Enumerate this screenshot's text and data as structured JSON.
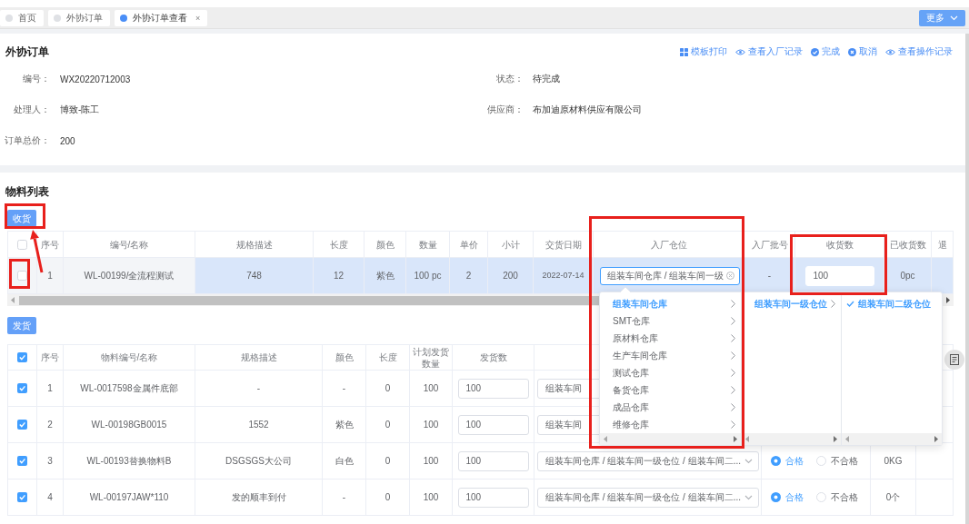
{
  "tabs": [
    {
      "label": "首页",
      "selected": false
    },
    {
      "label": "外协订单",
      "selected": false
    },
    {
      "label": "外协订单查看",
      "selected": true,
      "close": "×"
    }
  ],
  "more_button": {
    "label": "更多"
  },
  "order": {
    "title": "外协订单",
    "actions": [
      {
        "kind": "print",
        "label": "模板打印"
      },
      {
        "kind": "view",
        "label": "查看入厂记录"
      },
      {
        "kind": "complete",
        "label": "完成"
      },
      {
        "kind": "cancel",
        "label": "取消"
      },
      {
        "kind": "view",
        "label": "查看操作记录"
      }
    ],
    "fields": [
      {
        "label": "编号：",
        "value": "WX20220712003"
      },
      {
        "label": "状态：",
        "value": "待完成"
      },
      {
        "label": "处理人：",
        "value": "博致-陈工"
      },
      {
        "label": "供应商：",
        "value": "布加迪原材料供应有限公司"
      },
      {
        "label": "订单总价：",
        "value": "200"
      }
    ]
  },
  "materials": {
    "title": "物料列表",
    "receive_button": "收货",
    "receive_table": {
      "select_all": false,
      "columns": [
        "序号",
        "编号/名称",
        "规格描述",
        "长度",
        "颜色",
        "数量",
        "单价",
        "小计",
        "交货日期",
        "入厂仓位",
        "入厂批号",
        "收货数",
        "已收货数",
        "退"
      ],
      "rows": [
        {
          "selected": true,
          "checked": false,
          "cells": [
            {
              "kind": "text",
              "text": "1"
            },
            {
              "kind": "text",
              "text": "WL-00199/全流程测试"
            },
            {
              "kind": "text",
              "text": "748"
            },
            {
              "kind": "text",
              "text": "12"
            },
            {
              "kind": "text",
              "text": "紫色"
            },
            {
              "kind": "text",
              "text": "100 pc"
            },
            {
              "kind": "text",
              "text": "2"
            },
            {
              "kind": "text",
              "text": "200"
            },
            {
              "kind": "date",
              "text": "2022-07-14"
            },
            {
              "kind": "cascader",
              "value": "组装车间仓库 / 组装车间一级",
              "open": true
            },
            {
              "kind": "text",
              "text": "-"
            },
            {
              "kind": "input",
              "value": "100"
            },
            {
              "kind": "text",
              "text": "0pc"
            }
          ]
        }
      ]
    },
    "ship_button": "发货",
    "ship_table": {
      "select_all": true,
      "columns": [
        "序号",
        "物料编号/名称",
        "规格描述",
        "颜色",
        "长度",
        "计划发货数量",
        "发货数"
      ],
      "rows": [
        {
          "checked": true,
          "cells": [
            {
              "kind": "text",
              "text": "1"
            },
            {
              "kind": "text",
              "text": "WL-0017598金属件底部"
            },
            {
              "kind": "text",
              "text": "-"
            },
            {
              "kind": "text",
              "text": "-"
            },
            {
              "kind": "text",
              "text": "0"
            },
            {
              "kind": "text",
              "text": "100"
            },
            {
              "kind": "input",
              "value": "100"
            },
            {
              "kind": "select_partial",
              "value": "组装车间"
            }
          ]
        },
        {
          "checked": true,
          "cells": [
            {
              "kind": "text",
              "text": "2"
            },
            {
              "kind": "text",
              "text": "WL-00198GB0015"
            },
            {
              "kind": "text",
              "text": "1552"
            },
            {
              "kind": "text",
              "text": "紫色"
            },
            {
              "kind": "text",
              "text": "0"
            },
            {
              "kind": "text",
              "text": "100"
            },
            {
              "kind": "input",
              "value": "100"
            },
            {
              "kind": "select_partial",
              "value": "组装车间"
            }
          ]
        },
        {
          "checked": true,
          "cells": [
            {
              "kind": "text",
              "text": "3"
            },
            {
              "kind": "text",
              "text": "WL-00193替换物料B"
            },
            {
              "kind": "text",
              "text": "DSGSGS大公司"
            },
            {
              "kind": "text",
              "text": "白色"
            },
            {
              "kind": "text",
              "text": "0"
            },
            {
              "kind": "text",
              "text": "100"
            },
            {
              "kind": "input",
              "value": "100"
            },
            {
              "kind": "select",
              "value": "组装车间仓库 / 组装车间一级仓位 / 组装车间二..."
            },
            {
              "kind": "radio",
              "options": [
                {
                  "label": "合格",
                  "selected": true
                },
                {
                  "label": "不合格",
                  "selected": false
                }
              ]
            },
            {
              "kind": "text",
              "text": "0KG"
            }
          ]
        },
        {
          "checked": true,
          "cells": [
            {
              "kind": "text",
              "text": "4"
            },
            {
              "kind": "text",
              "text": "WL-00197JAW*110"
            },
            {
              "kind": "text",
              "text": "发的顺丰到付"
            },
            {
              "kind": "text",
              "text": "-"
            },
            {
              "kind": "text",
              "text": "0"
            },
            {
              "kind": "text",
              "text": "100"
            },
            {
              "kind": "input",
              "value": "100"
            },
            {
              "kind": "select",
              "value": "组装车间仓库 / 组装车间一级仓位 / 组装车间二..."
            },
            {
              "kind": "radio",
              "options": [
                {
                  "label": "合格",
                  "selected": true
                },
                {
                  "label": "不合格",
                  "selected": false
                }
              ]
            },
            {
              "kind": "text",
              "text": "0个"
            }
          ]
        }
      ]
    }
  },
  "cascader_menu": {
    "columns": [
      {
        "items": [
          {
            "label": "组装车间仓库",
            "selected": true,
            "has_children": true
          },
          {
            "label": "SMT仓库",
            "selected": false,
            "has_children": true
          },
          {
            "label": "原材料仓库",
            "selected": false,
            "has_children": true
          },
          {
            "label": "生产车间仓库",
            "selected": false,
            "has_children": true
          },
          {
            "label": "测试仓库",
            "selected": false,
            "has_children": true
          },
          {
            "label": "备货仓库",
            "selected": false,
            "has_children": true
          },
          {
            "label": "成品仓库",
            "selected": false,
            "has_children": true
          },
          {
            "label": "维修仓库",
            "selected": false,
            "has_children": true
          }
        ]
      },
      {
        "items": [
          {
            "label": "组装车间一级仓位",
            "selected": true,
            "has_children": true
          }
        ]
      },
      {
        "items": [
          {
            "label": "组装车间二级仓位",
            "selected": true,
            "has_children": false,
            "checked": true
          }
        ]
      }
    ]
  },
  "annotations": [
    {
      "kind": "box"
    },
    {
      "kind": "box"
    },
    {
      "kind": "box"
    },
    {
      "kind": "box"
    },
    {
      "kind": "arrow"
    }
  ]
}
